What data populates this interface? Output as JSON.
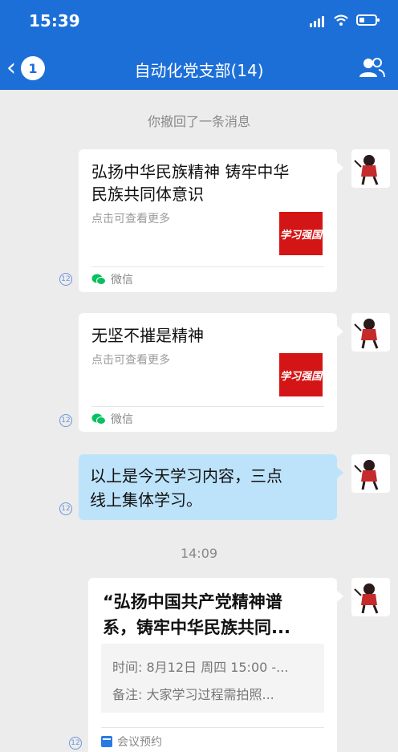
{
  "status_bar": {
    "time": "15:39"
  },
  "header": {
    "unread_count": "1",
    "title": "自动化党支部(14)"
  },
  "chat": {
    "recalled_notice": "你撤回了一条消息",
    "timestamp": "14:09",
    "read_receipt": "12",
    "messages": [
      {
        "type": "article",
        "title_line1": "弘扬中华民族精神 铸牢中华",
        "title_line2": "民族共同体意识",
        "subtitle": "点击可查看更多",
        "thumb_brand": "学习强国",
        "source": "微信"
      },
      {
        "type": "article",
        "title_line1": "无坚不摧是精神",
        "subtitle": "点击可查看更多",
        "thumb_brand": "学习强国",
        "source": "微信"
      },
      {
        "type": "text",
        "line1": "以上是今天学习内容，三点",
        "line2": "线上集体学习。"
      },
      {
        "type": "meeting",
        "title_line1": "“弘扬中国共产党精神谱",
        "title_line2": "系，铸牢中华民族共同...",
        "time_line": "时间: 8月12日 周四 15:00 -...",
        "note_line": "备注: 大家学习过程需拍照...",
        "source": "会议预约"
      }
    ]
  },
  "colors": {
    "header_bg": "#1d6fd8",
    "bubble_bg": "#bde3fb",
    "thumb_bg": "#d41515",
    "wechat_green": "#07c160"
  }
}
